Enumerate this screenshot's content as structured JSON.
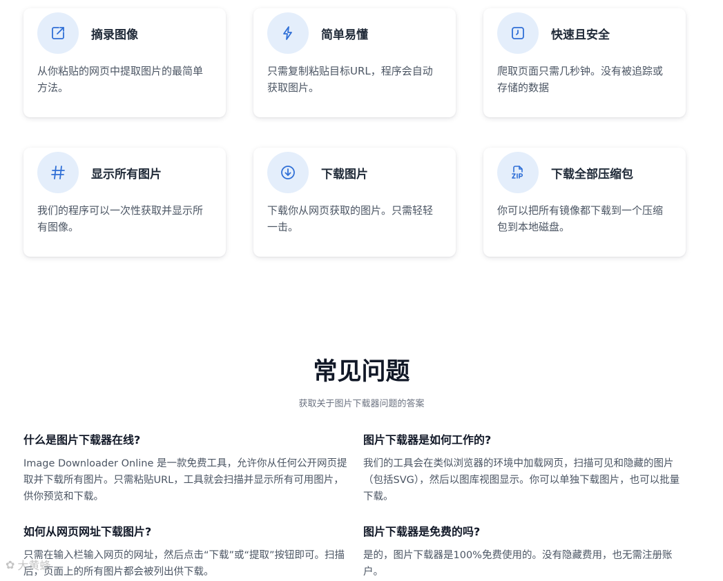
{
  "features": [
    {
      "icon": "external-link-icon",
      "title": "摘录图像",
      "desc": "从你粘贴的网页中提取图片的最简单方法。"
    },
    {
      "icon": "lightning-icon",
      "title": "简单易懂",
      "desc": "只需复制粘贴目标URL，程序会自动获取图片。"
    },
    {
      "icon": "timer-icon",
      "title": "快速且安全",
      "desc": "爬取页面只需几秒钟。没有被追踪或存储的数据"
    },
    {
      "icon": "hashtag-icon",
      "title": "显示所有图片",
      "desc": "我们的程序可以一次性获取并显示所有图像。"
    },
    {
      "icon": "download-icon",
      "title": "下载图片",
      "desc": "下载你从网页获取的图片。只需轻轻一击。"
    },
    {
      "icon": "zip-file-icon",
      "title": "下载全部压缩包",
      "desc": "你可以把所有镜像都下载到一个压缩包到本地磁盘。"
    }
  ],
  "faq": {
    "title": "常见问题",
    "subtitle": "获取关于图片下载器问题的答案",
    "items": [
      {
        "q": "什么是图片下载器在线?",
        "a": "Image Downloader Online 是一款免费工具，允许你从任何公开网页提取并下载所有图片。只需粘贴URL，工具就会扫描并显示所有可用图片，供你预览和下载。"
      },
      {
        "q": "图片下载器是如何工作的?",
        "a": "我们的工具会在类似浏览器的环境中加载网页，扫描可见和隐藏的图片（包括SVG），然后以图库视图显示。你可以单独下载图片，也可以批量下载。"
      },
      {
        "q": "如何从网页网址下载图片?",
        "a": "只需在输入栏输入网页的网址，然后点击“下载”或“提取”按钮即可。扫描后，页面上的所有图片都会被列出供下载。"
      },
      {
        "q": "图片下载器是免费的吗?",
        "a": "是的，图片下载器是100%免费使用的。没有隐藏费用，也无需注册账户。"
      }
    ]
  },
  "watermark": "大黄蜂"
}
